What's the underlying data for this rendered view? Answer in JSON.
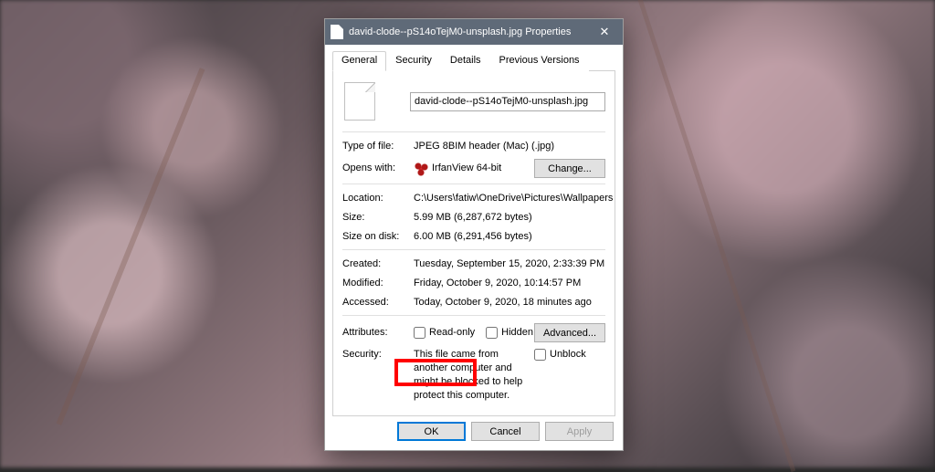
{
  "window": {
    "title": "david-clode--pS14oTejM0-unsplash.jpg Properties",
    "close_glyph": "✕"
  },
  "tabs": {
    "general": "General",
    "security": "Security",
    "details": "Details",
    "previous": "Previous Versions"
  },
  "file": {
    "name": "david-clode--pS14oTejM0-unsplash.jpg"
  },
  "labels": {
    "type": "Type of file:",
    "opens": "Opens with:",
    "location": "Location:",
    "size": "Size:",
    "size_on_disk": "Size on disk:",
    "created": "Created:",
    "modified": "Modified:",
    "accessed": "Accessed:",
    "attributes": "Attributes:",
    "security": "Security:"
  },
  "values": {
    "type": "JPEG 8BIM header (Mac) (.jpg)",
    "opens": "IrfanView 64-bit",
    "location": "C:\\Users\\fatiw\\OneDrive\\Pictures\\Wallpapers",
    "size": "5.99 MB (6,287,672 bytes)",
    "size_on_disk": "6.00 MB (6,291,456 bytes)",
    "created": "Tuesday, September 15, 2020, 2:33:39 PM",
    "modified": "Friday, October 9, 2020, 10:14:57 PM",
    "accessed": "Today, October 9, 2020, 18 minutes ago",
    "security_msg": "This file came from another computer and might be blocked to help protect this computer."
  },
  "buttons": {
    "change": "Change...",
    "advanced": "Advanced...",
    "ok": "OK",
    "cancel": "Cancel",
    "apply": "Apply"
  },
  "checkboxes": {
    "readonly": "Read-only",
    "hidden": "Hidden",
    "unblock": "Unblock"
  }
}
